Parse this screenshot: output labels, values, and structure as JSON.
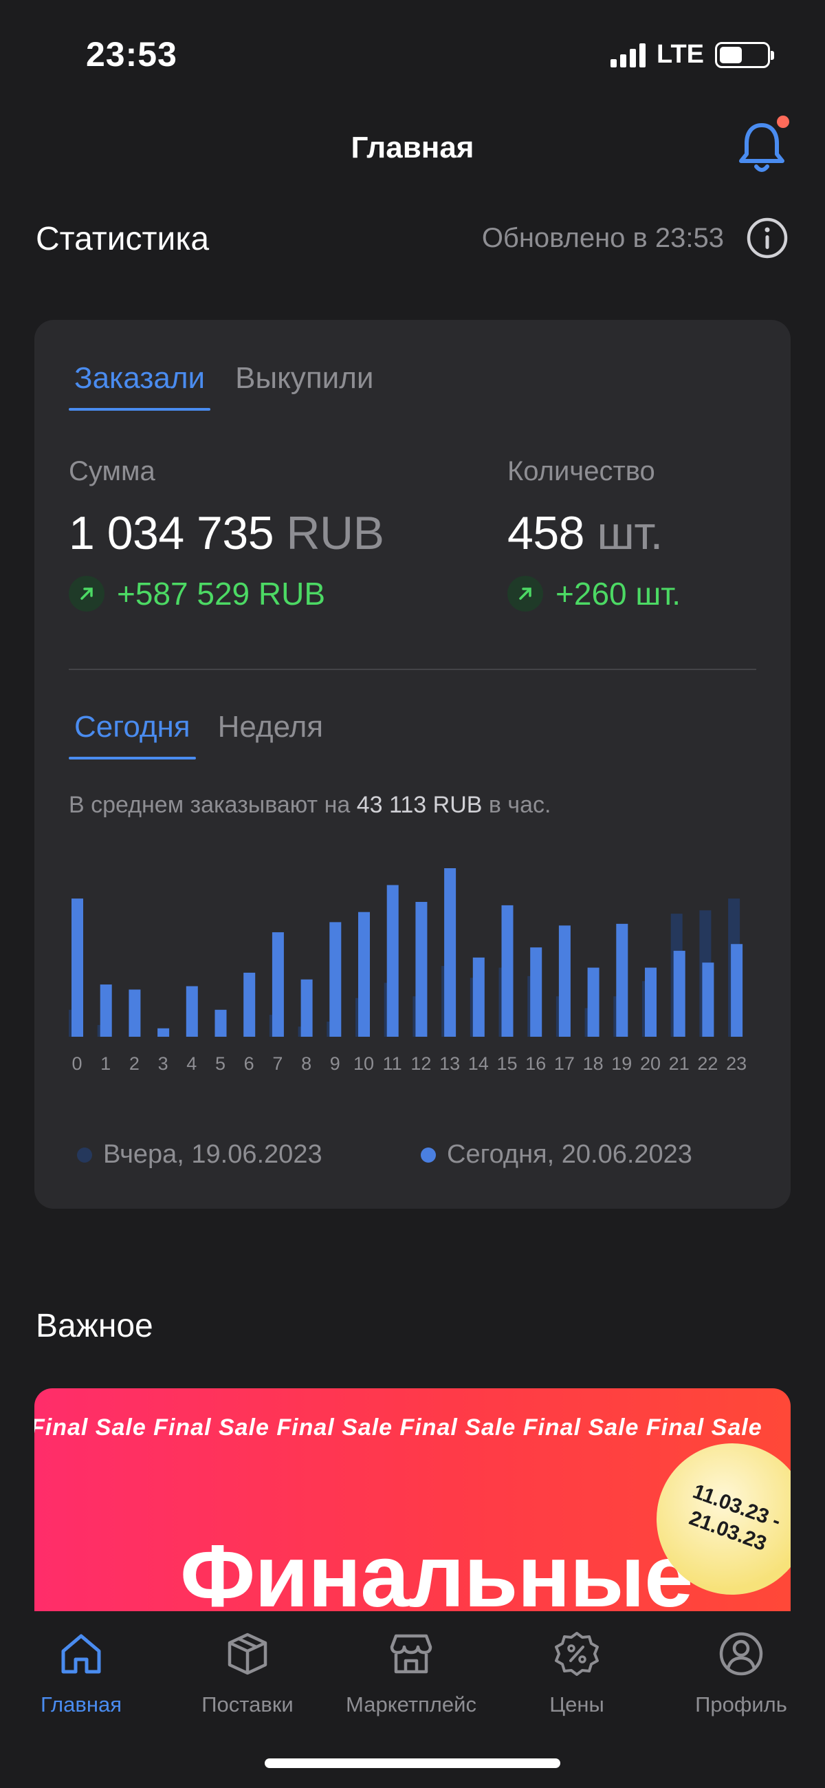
{
  "status_bar": {
    "time": "23:53",
    "network": "LTE"
  },
  "nav": {
    "title": "Главная"
  },
  "stats": {
    "title": "Статистика",
    "updated": "Обновлено в 23:53",
    "tabs": [
      {
        "label": "Заказали"
      },
      {
        "label": "Выкупили"
      }
    ],
    "sum": {
      "label": "Сумма",
      "value": "1 034 735",
      "unit": "RUB",
      "delta": "+587 529 RUB"
    },
    "count": {
      "label": "Количество",
      "value": "458",
      "unit": "шт.",
      "delta": "+260 шт."
    },
    "period_tabs": [
      {
        "label": "Сегодня"
      },
      {
        "label": "Неделя"
      }
    ],
    "avg": {
      "prefix": "В среднем заказывают на",
      "amount": "43 113 RUB",
      "suffix": "в час."
    }
  },
  "chart_data": {
    "type": "bar",
    "categories": [
      "0",
      "1",
      "2",
      "3",
      "4",
      "5",
      "6",
      "7",
      "8",
      "9",
      "10",
      "11",
      "12",
      "13",
      "14",
      "15",
      "16",
      "17",
      "18",
      "19",
      "20",
      "21",
      "22",
      "23"
    ],
    "series": [
      {
        "name": "Вчера, 19.06.2023",
        "color": "#25385c",
        "values": [
          16,
          7,
          0,
          0,
          0,
          0,
          0,
          13,
          6,
          9,
          23,
          32,
          24,
          42,
          35,
          41,
          36,
          24,
          17,
          24,
          33,
          73,
          75,
          82
        ]
      },
      {
        "name": "Сегодня, 20.06.2023",
        "color": "#4a7fe0",
        "values": [
          82,
          31,
          28,
          5,
          30,
          16,
          38,
          62,
          34,
          68,
          74,
          90,
          80,
          100,
          47,
          78,
          53,
          66,
          41,
          67,
          41,
          51,
          44,
          55
        ]
      }
    ],
    "ylim": [
      0,
      100
    ]
  },
  "important": {
    "title": "Важное",
    "banner": {
      "strip": "Final Sale Final Sale Final Sale Final Sale Final Sale Final Sale",
      "headline": "Финальные",
      "date_from": "11.03.23 -",
      "date_to": "21.03.23"
    }
  },
  "tabbar": {
    "items": [
      {
        "label": "Главная",
        "icon": "home-icon"
      },
      {
        "label": "Поставки",
        "icon": "box-icon"
      },
      {
        "label": "Маркетплейс",
        "icon": "store-icon"
      },
      {
        "label": "Цены",
        "icon": "percent-icon"
      },
      {
        "label": "Профиль",
        "icon": "profile-icon"
      }
    ]
  },
  "colors": {
    "accent": "#4a8cf0",
    "positive": "#4cd964",
    "background": "#1c1c1e",
    "card": "#2a2a2d"
  }
}
